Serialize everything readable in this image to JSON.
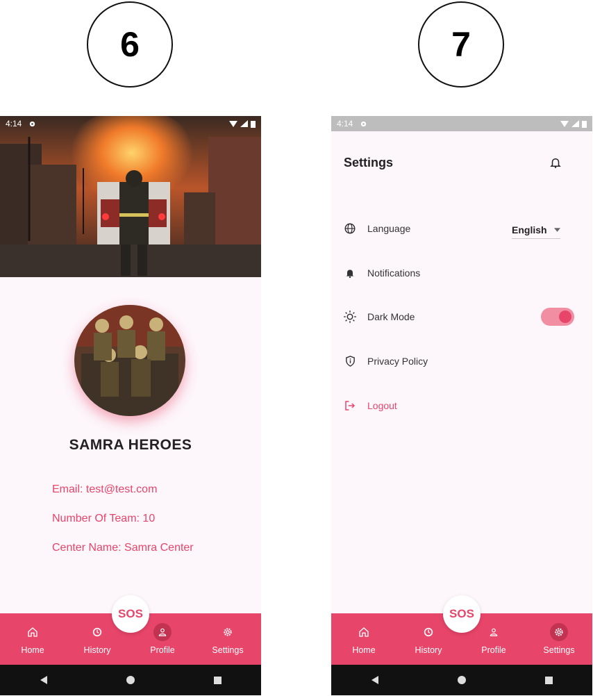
{
  "badges": {
    "left": "6",
    "right": "7"
  },
  "status_bar": {
    "time": "4:14"
  },
  "profile": {
    "team_name": "SAMRA HEROES",
    "email": "Email: test@test.com",
    "team_count": "Number Of Team: 10",
    "center_name": "Center Name: Samra Center"
  },
  "settings": {
    "title": "Settings",
    "language_label": "Language",
    "language_value": "English",
    "notifications_label": "Notifications",
    "dark_mode_label": "Dark Mode",
    "dark_mode_on": true,
    "privacy_label": "Privacy Policy",
    "logout_label": "Logout"
  },
  "nav": {
    "sos": "SOS",
    "home": "Home",
    "history": "History",
    "profile": "Profile",
    "settings": "Settings"
  },
  "colors": {
    "accent": "#e8456a",
    "background": "#fdf6fb",
    "system_nav": "#111111"
  },
  "icons": [
    "gear-icon",
    "wifi-icon",
    "signal-icon",
    "battery-icon",
    "home-icon",
    "history-icon",
    "person-icon",
    "globe-icon",
    "bell-icon",
    "sun-icon",
    "shield-icon",
    "logout-icon",
    "back-icon",
    "home-circle-icon",
    "recents-icon",
    "dropdown-caret-icon"
  ]
}
